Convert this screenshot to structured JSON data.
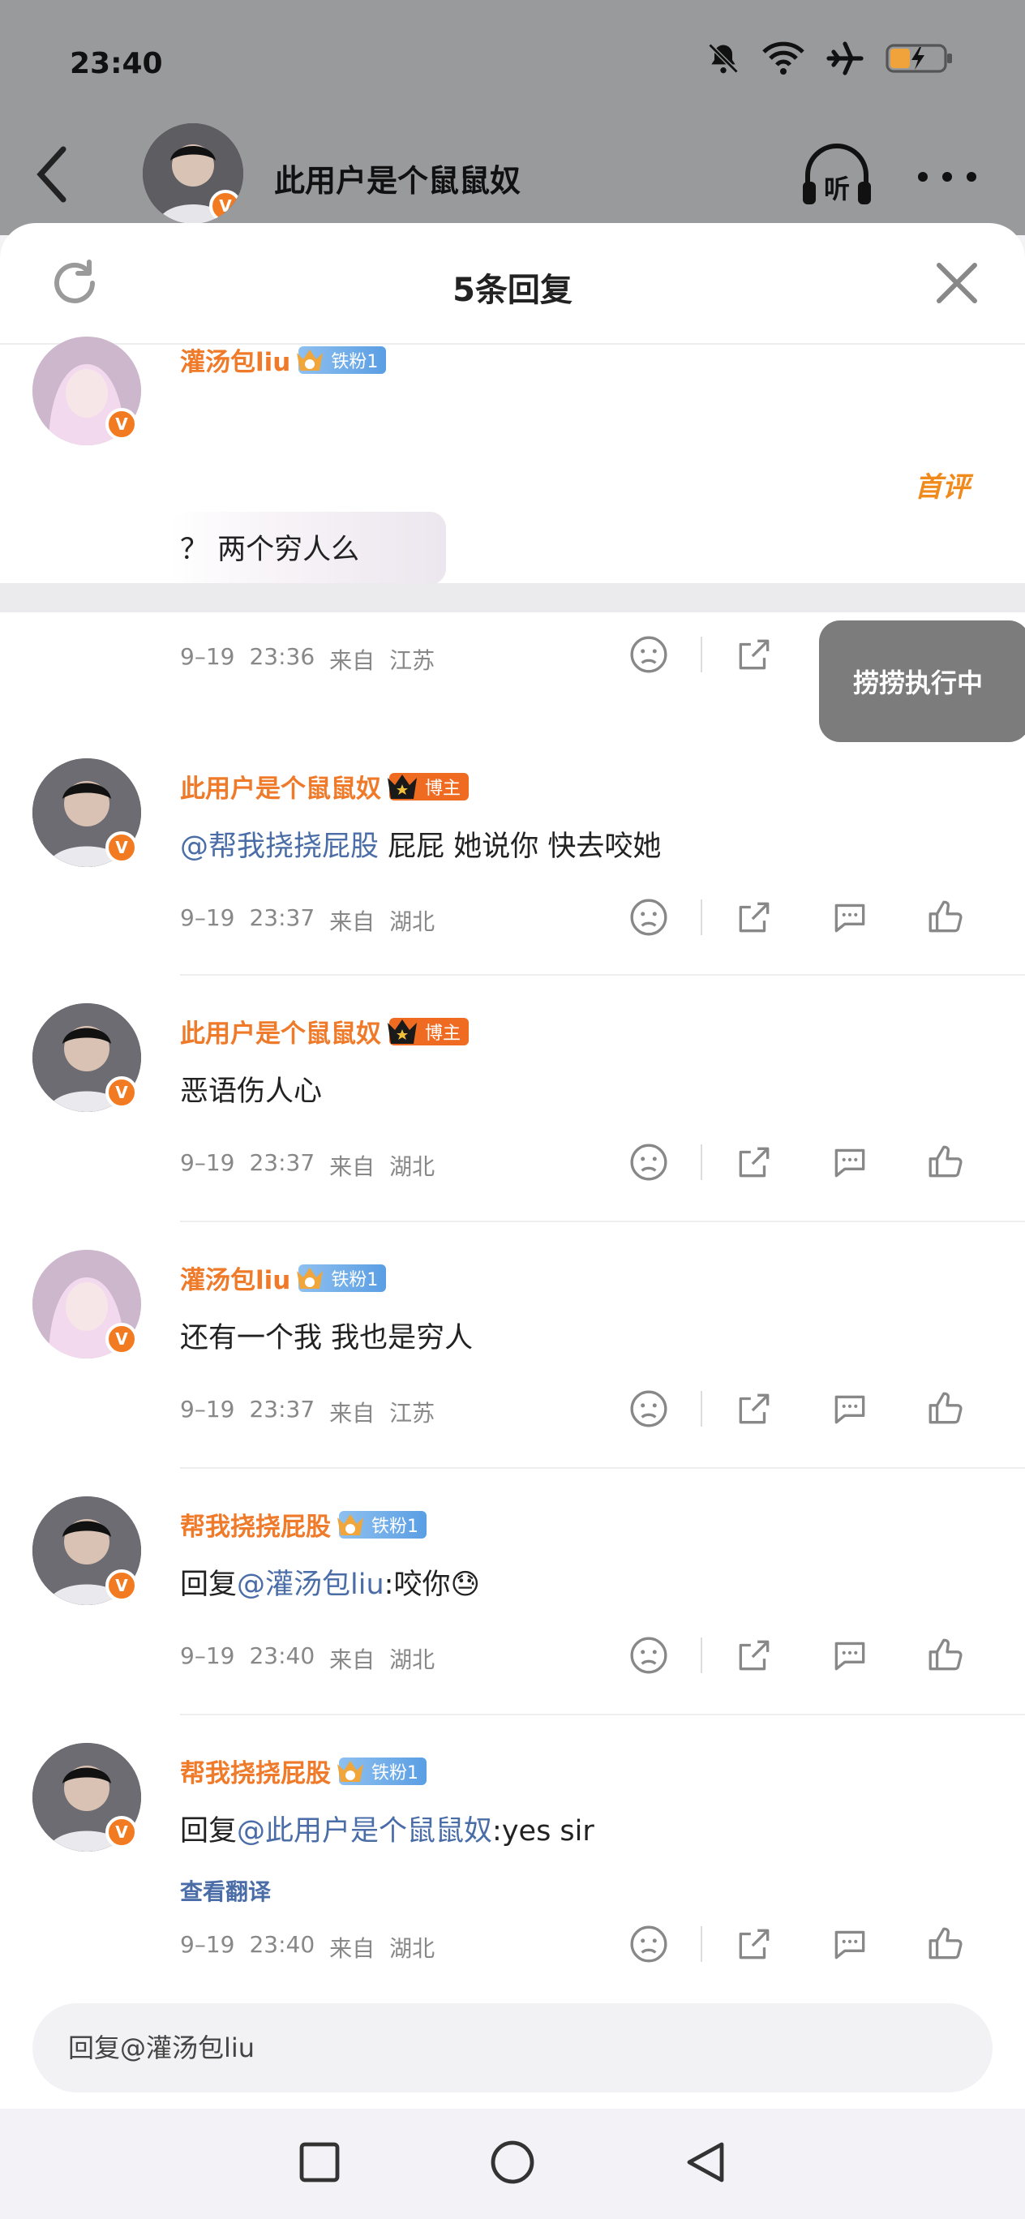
{
  "status_bar": {
    "time": "23:40"
  },
  "background_header": {
    "title": "此用户是个鼠鼠奴",
    "listen_label": "听"
  },
  "sheet": {
    "title": "5条回复"
  },
  "toast": {
    "text": "捞捞执行中"
  },
  "first_comment": {
    "name": "灌汤包liu",
    "badge": "铁粉1",
    "sticker": "首评",
    "text": "？ 两个穷人么",
    "date": "9–19",
    "time": "23:36",
    "from": "来自",
    "location": "江苏"
  },
  "replies": [
    {
      "name": "此用户是个鼠鼠奴",
      "badge": "博主",
      "badge_type": "host",
      "at": "@帮我挠挠屁股",
      "text": " 屁屁  她说你  快去咬她",
      "date": "9–19",
      "time": "23:37",
      "from": "来自",
      "location": "湖北"
    },
    {
      "name": "此用户是个鼠鼠奴",
      "badge": "博主",
      "badge_type": "host",
      "at": "",
      "text": "恶语伤人心",
      "date": "9–19",
      "time": "23:37",
      "from": "来自",
      "location": "湖北"
    },
    {
      "name": "灌汤包liu",
      "badge": "铁粉1",
      "badge_type": "fan",
      "at": "",
      "text": "还有一个我  我也是穷人",
      "date": "9–19",
      "time": "23:37",
      "from": "来自",
      "location": "江苏"
    },
    {
      "name": "帮我挠挠屁股",
      "badge": "铁粉1",
      "badge_type": "fan",
      "prefix": "回复",
      "at": "@灌汤包liu",
      "text": ":咬你😓",
      "date": "9–19",
      "time": "23:40",
      "from": "来自",
      "location": "湖北"
    },
    {
      "name": "帮我挠挠屁股",
      "badge": "铁粉1",
      "badge_type": "fan",
      "prefix": "回复",
      "at": "@此用户是个鼠鼠奴",
      "text": ":yes  sir",
      "translate": "查看翻译",
      "date": "9–19",
      "time": "23:40",
      "from": "来自",
      "location": "湖北"
    }
  ],
  "reply_input": {
    "placeholder": "回复@灌汤包liu"
  },
  "icons": [
    "bell-off-icon",
    "wifi-icon",
    "airplane-icon",
    "battery-icon",
    "back-icon",
    "headphones-icon",
    "more-icon",
    "refresh-icon",
    "close-icon",
    "frown-icon",
    "share-icon",
    "comment-icon",
    "like-icon",
    "square-nav-icon",
    "circle-nav-icon",
    "triangle-nav-icon"
  ],
  "colors": {
    "accent_orange": "#ef7a2a",
    "link_blue": "#4a6da7",
    "fan_badge": "#6aa8e8",
    "host_badge": "#f06b22"
  }
}
